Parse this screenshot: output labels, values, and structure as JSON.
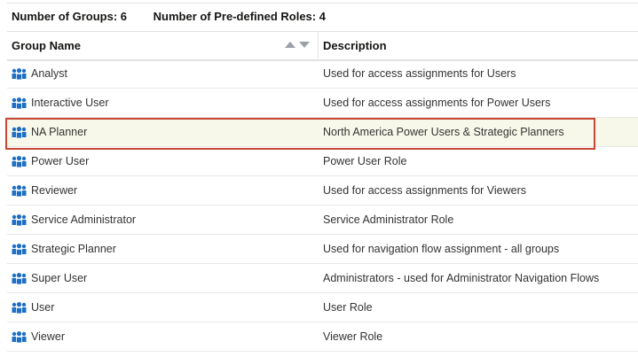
{
  "summary": {
    "groups": "Number of Groups: 6",
    "roles": "Number of Pre-defined Roles: 4"
  },
  "columns": {
    "name": "Group Name",
    "description": "Description"
  },
  "rows": [
    {
      "name": "Analyst",
      "description": "Used for access assignments for Users"
    },
    {
      "name": "Interactive User",
      "description": "Used for access assignments for Power Users"
    },
    {
      "name": "NA Planner",
      "description": "North America Power Users & Strategic Planners",
      "selected": true
    },
    {
      "name": "Power User",
      "description": "Power User Role"
    },
    {
      "name": "Reviewer",
      "description": "Used for access assignments for Viewers"
    },
    {
      "name": "Service Administrator",
      "description": "Service Administrator Role"
    },
    {
      "name": "Strategic Planner",
      "description": "Used for navigation flow assignment - all groups"
    },
    {
      "name": "Super User",
      "description": "Administrators - used for Administrator Navigation Flows"
    },
    {
      "name": "User",
      "description": "User Role"
    },
    {
      "name": "Viewer",
      "description": "Viewer Role"
    }
  ],
  "colors": {
    "icon": "#1d6fc4",
    "selection_border": "#c74634",
    "selection_bg": "#f8f8ea"
  }
}
